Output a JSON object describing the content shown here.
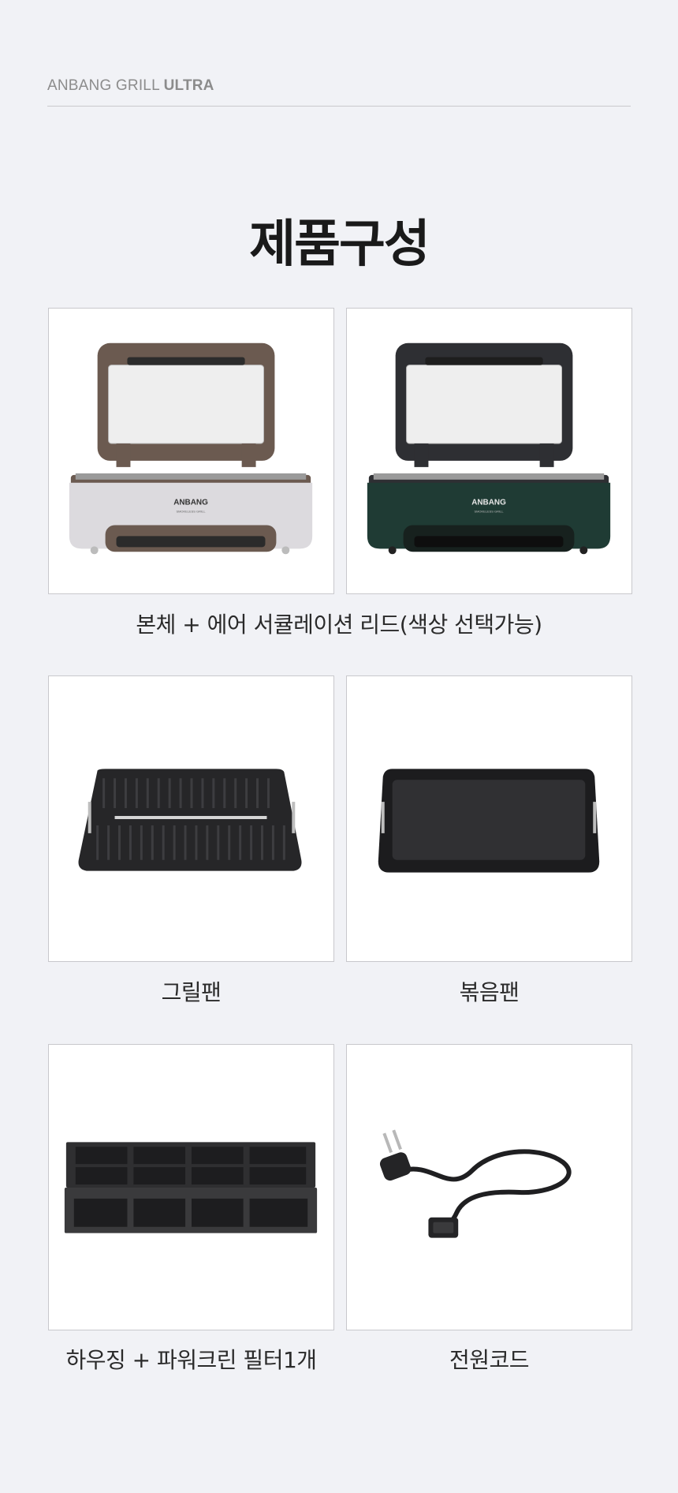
{
  "header": {
    "brand_prefix": "ANBANG GRILL",
    "brand_strong": "ULTRA"
  },
  "page": {
    "title": "제품구성"
  },
  "products": {
    "grill_white": {
      "logo": "ANBANG",
      "sub": "SMOKELESS GRILL",
      "image": "grill-body-white-image"
    },
    "grill_green": {
      "logo": "ANBANG",
      "sub": "SMOKELESS GRILL",
      "image": "grill-body-green-image"
    },
    "main_caption": "본체 + 에어 서큘레이션 리드(색상 선택가능)",
    "grill_pan": {
      "caption": "그릴팬",
      "image": "grill-pan-image"
    },
    "fry_pan": {
      "caption": "볶음팬",
      "image": "fry-pan-image"
    },
    "filter": {
      "caption": "하우징 + 파워크린 필터1개",
      "image": "filter-housing-image"
    },
    "cord": {
      "caption": "전원코드",
      "image": "power-cord-image"
    }
  },
  "colors": {
    "background": "#f1f2f6",
    "lid_brown": "#6b5a50",
    "body_white": "#dcdade",
    "body_green": "#1f3b34",
    "pan_black": "#262628"
  }
}
